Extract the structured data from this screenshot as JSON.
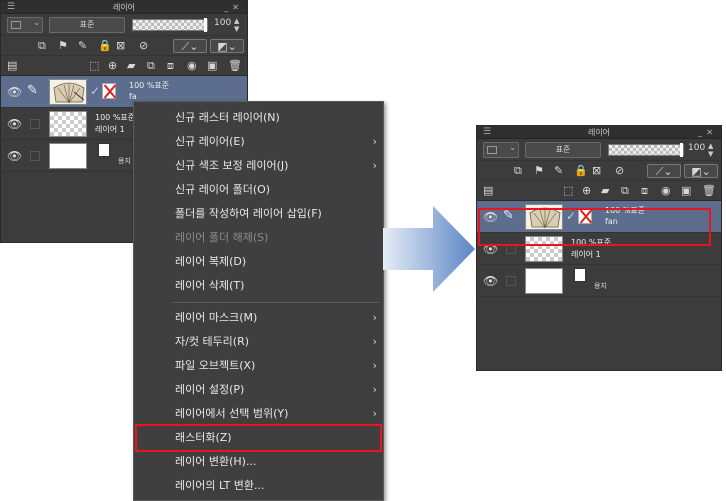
{
  "left_panel": {
    "title": "레이어",
    "blend_mode": "표준",
    "opacity": "100",
    "layers": [
      {
        "opacity_mode": "100 %표준",
        "name": "fan",
        "name_visible": "fa"
      },
      {
        "opacity_mode": "100 %표준",
        "name": "레이어 1"
      },
      {
        "name": "용지"
      }
    ]
  },
  "context_menu": {
    "items": [
      {
        "label": "신규 래스터 레이어(N)",
        "submenu": false,
        "disabled": false
      },
      {
        "label": "신규 레이어(E)",
        "submenu": true,
        "disabled": false
      },
      {
        "label": "신규 색조 보정 레이어(J)",
        "submenu": true,
        "disabled": false
      },
      {
        "label": "신규 레이어 폴더(O)",
        "submenu": false,
        "disabled": false
      },
      {
        "label": "폴더를 작성하여 레이어 삽입(F)",
        "submenu": false,
        "disabled": false
      },
      {
        "label": "레이어 폴더 해제(S)",
        "submenu": false,
        "disabled": true
      },
      {
        "label": "레이어 복제(D)",
        "submenu": false,
        "disabled": false
      },
      {
        "label": "레이어 삭제(T)",
        "submenu": false,
        "disabled": false
      },
      {
        "label": "레이어 마스크(M)",
        "submenu": true,
        "disabled": false
      },
      {
        "label": "자/컷 테두리(R)",
        "submenu": true,
        "disabled": false
      },
      {
        "label": "파일 오브젝트(X)",
        "submenu": true,
        "disabled": false
      },
      {
        "label": "레이어 설정(P)",
        "submenu": true,
        "disabled": false
      },
      {
        "label": "레이어에서 선택 범위(Y)",
        "submenu": true,
        "disabled": false
      },
      {
        "label": "래스터화(Z)",
        "submenu": false,
        "disabled": false
      },
      {
        "label": "레이어 변환(H)...",
        "submenu": false,
        "disabled": false
      },
      {
        "label": "레이어의 LT 변환...",
        "submenu": false,
        "disabled": false
      }
    ],
    "submenu_glyph": "›"
  },
  "right_panel": {
    "title": "레이어",
    "blend_mode": "표준",
    "opacity": "100",
    "layers": [
      {
        "opacity_mode": "100 %표준",
        "name": "fan"
      },
      {
        "opacity_mode": "100 %표준",
        "name": "레이어 1"
      },
      {
        "name": "용지"
      }
    ]
  },
  "colors": {
    "highlight_red": "#e8141e",
    "selected_row": "#5d6d8d",
    "arrow_start": "#e6edf6",
    "arrow_end": "#5b85c5"
  }
}
